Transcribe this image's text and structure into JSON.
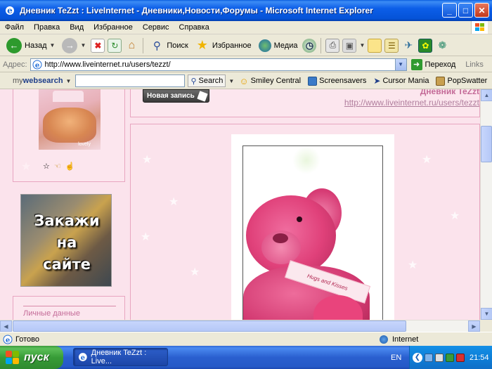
{
  "window": {
    "title": "Дневник TeZzt : LiveInternet - Дневники,Новости,Форумы - Microsoft Internet Explorer",
    "minimize": "_",
    "maximize": "□",
    "close": "✕"
  },
  "menu": {
    "items": [
      "Файл",
      "Правка",
      "Вид",
      "Избранное",
      "Сервис",
      "Справка"
    ]
  },
  "toolbar": {
    "back_label": "Назад",
    "search_label": "Поиск",
    "favorites_label": "Избранное",
    "media_label": "Медиа"
  },
  "address": {
    "label": "Адрес:",
    "url": "http://www.liveinternet.ru/users/tezzt/",
    "go_label": "Переход",
    "links_label": "Links"
  },
  "searchbar": {
    "brand_prefix": "my",
    "brand_main": "websearch",
    "search_label": "Search",
    "items": [
      "Smiley Central",
      "Screensavers",
      "Cursor Mania",
      "PopSwatter"
    ]
  },
  "page": {
    "new_post_label": "Новая запись",
    "diary_title": "Дневник TeZzt",
    "diary_url": "http://www.liveinternet.ru/users/tezzt",
    "kitten_watermark": "lovely",
    "banner_lines": [
      "Закажи",
      "на",
      "сайте"
    ],
    "personal_label": "Личные данные",
    "ribbon_text": "Hugs and Kisses"
  },
  "status": {
    "text": "Готово",
    "zone": "Internet"
  },
  "taskbar": {
    "start_label": "пуск",
    "task_label": "Дневник TeZzt : Live...",
    "lang": "EN",
    "clock": "21:54"
  }
}
